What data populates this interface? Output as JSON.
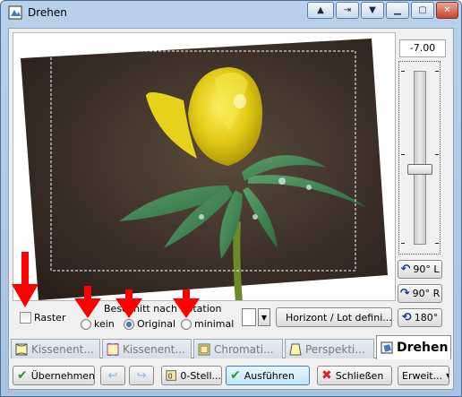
{
  "window": {
    "title": "Drehen"
  },
  "rotation": {
    "angle_value": "-7.00",
    "slider_level_degrees": -7.0
  },
  "rotate_buttons": [
    {
      "label": "90° L",
      "icon": "rotate-left-icon"
    },
    {
      "label": "90° R",
      "icon": "rotate-right-icon"
    },
    {
      "label": "180°",
      "icon": "rotate-180-icon"
    }
  ],
  "options": {
    "raster_label": "Raster",
    "raster_checked": false,
    "crop_group_label": "Beschnitt nach Rotation",
    "crop_options": [
      {
        "label": "kein",
        "selected": false
      },
      {
        "label": "Original",
        "selected": true
      },
      {
        "label": "minimal",
        "selected": false
      }
    ],
    "horizont_button": "Horizont / Lot defini..."
  },
  "tabs": [
    {
      "label": "Kissenent...",
      "active": false
    },
    {
      "label": "Kissenent...",
      "active": false
    },
    {
      "label": "Chromati...",
      "active": false
    },
    {
      "label": "Perspekti...",
      "active": false
    },
    {
      "label": "Drehen",
      "active": true
    }
  ],
  "bottom_buttons": {
    "apply": "Übernehmen",
    "undo": "",
    "redo": "",
    "reset": "0-Stell...",
    "execute": "Ausführen",
    "close": "Schließen",
    "extended": "Erweit..."
  },
  "colors": {
    "annotation_arrow": "#ff0000",
    "title_gradient": "#b9d1ea",
    "flower": "#e6d21a"
  }
}
